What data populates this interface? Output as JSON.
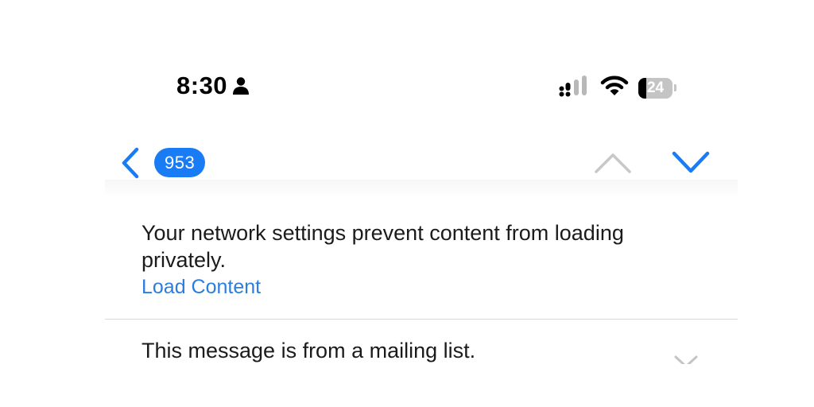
{
  "status_bar": {
    "time": "8:30",
    "battery_level": 24,
    "battery_label": "24",
    "icons": [
      "person-icon",
      "cellular-signal-icon",
      "wifi-icon",
      "battery-icon"
    ]
  },
  "nav": {
    "unread_count": "953",
    "icons": [
      "chevron-left-icon",
      "chevron-up-icon",
      "chevron-down-icon"
    ],
    "accent_color": "#1a7cf5",
    "disabled_color": "#c8c8c8"
  },
  "banner": {
    "message": "Your network settings prevent content from loading privately.",
    "action_label": "Load Content",
    "link_color": "#2a7de1"
  },
  "mailing_list": {
    "message": "This message is from a mailing list.",
    "icon": "chevron-down-icon"
  }
}
